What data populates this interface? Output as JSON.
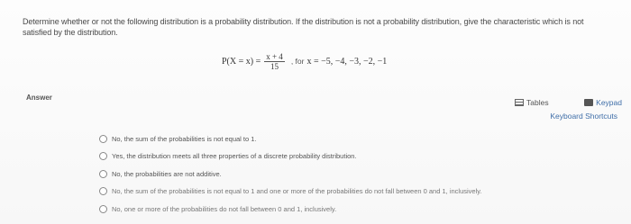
{
  "question": {
    "text": "Determine whether or not the following distribution is a probability distribution. If the distribution is not a probability distribution, give the characteristic which is not satisfied by the distribution."
  },
  "formula": {
    "lhs": "P(X = x) =",
    "numerator": "x + 4",
    "denominator": "15",
    "condition_prefix": ", for",
    "condition_values": "x = −5, −4, −3, −2, −1"
  },
  "answer": {
    "label": "Answer"
  },
  "tools": {
    "tables_label": "Tables",
    "keypad_label": "Keypad",
    "shortcuts_label": "Keyboard Shortcuts"
  },
  "options": [
    {
      "text": "No, the sum of the probabilities is not equal to 1."
    },
    {
      "text": "Yes, the distribution meets all three properties of a discrete probability distribution."
    },
    {
      "text": "No, the probabilities are not additive."
    },
    {
      "text": "No, the sum of the probabilities is not equal to 1 and one or more of the probabilities do not fall between 0 and 1, inclusively."
    },
    {
      "text": "No, one or more of the probabilities do not fall between 0 and 1, inclusively."
    }
  ]
}
